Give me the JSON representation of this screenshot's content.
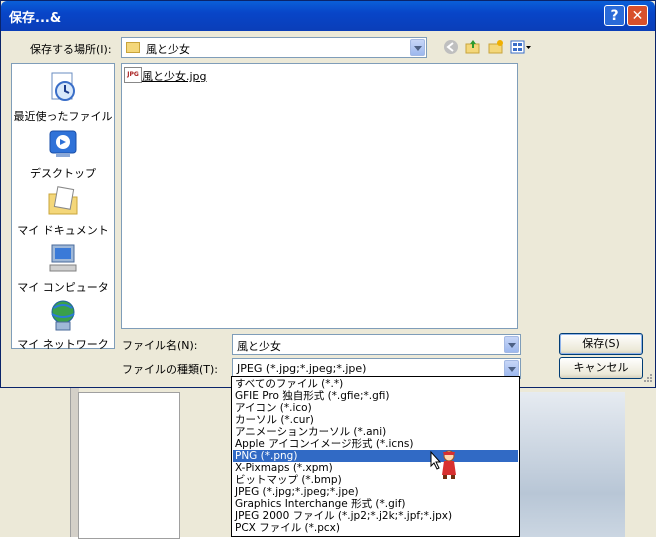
{
  "title": "保存...&",
  "title_buttons": {
    "help": "?",
    "close": "✕"
  },
  "save_in": {
    "label": "保存する場所(I):",
    "value": "風と少女"
  },
  "places": [
    {
      "label": "最近使ったファイル",
      "icon": "recent-icon"
    },
    {
      "label": "デスクトップ",
      "icon": "desktop-icon"
    },
    {
      "label": "マイ ドキュメント",
      "icon": "my-documents-icon"
    },
    {
      "label": "マイ コンピュータ",
      "icon": "my-computer-icon"
    },
    {
      "label": "マイ ネットワーク",
      "icon": "my-network-icon"
    }
  ],
  "files": [
    {
      "name": "風と少女.jpg",
      "badge": "JPG"
    }
  ],
  "filename": {
    "label": "ファイル名(N):",
    "value": "風と少女"
  },
  "filetype": {
    "label": "ファイルの種類(T):",
    "value": "JPEG (*.jpg;*.jpeg;*.jpe)"
  },
  "buttons": {
    "save": "保存(S)",
    "cancel": "キャンセル"
  },
  "filetype_options": [
    "すべてのファイル (*.*)",
    "GFIE Pro 独自形式 (*.gfie;*.gfi)",
    "アイコン (*.ico)",
    "カーソル (*.cur)",
    "アニメーションカーソル (*.ani)",
    "Apple アイコンイメージ形式 (*.icns)",
    "PNG (*.png)",
    "X-Pixmaps (*.xpm)",
    "ビットマップ (*.bmp)",
    "JPEG (*.jpg;*.jpeg;*.jpe)",
    "Graphics Interchange 形式 (*.gif)",
    "JPEG 2000 ファイル (*.jp2;*.j2k;*.jpf;*.jpx)",
    "PCX ファイル (*.pcx)"
  ],
  "selected_option_index": 6,
  "colors": {
    "titlebar": "#0a46c8",
    "selection": "#316ac5",
    "dialog_bg": "#ece9d8"
  }
}
